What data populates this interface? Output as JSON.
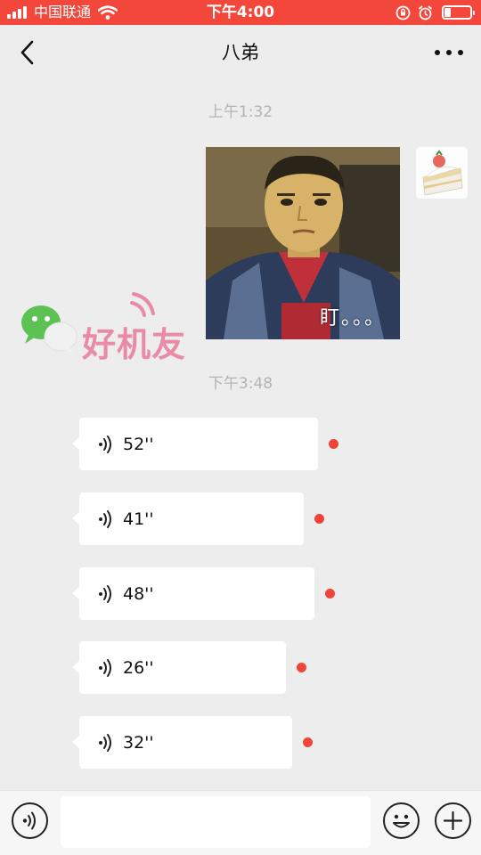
{
  "status_bar": {
    "carrier": "中国联通",
    "time": "下午4:00",
    "battery_level": 0.25,
    "background_color": "#f2473a"
  },
  "nav": {
    "title": "八弟",
    "back_icon": "chevron-left-icon",
    "more_icon": "ellipsis-icon"
  },
  "chat": {
    "timestamps": [
      "上午1:32",
      "下午3:48"
    ],
    "image_message": {
      "caption": "盯。。。"
    },
    "voice_messages": [
      {
        "duration": "52''",
        "unread": true
      },
      {
        "duration": "41''",
        "unread": true
      },
      {
        "duration": "48''",
        "unread": true
      },
      {
        "duration": "26''",
        "unread": true
      },
      {
        "duration": "32''",
        "unread": true
      }
    ]
  },
  "watermark": {
    "text": "好机友"
  },
  "input_bar": {
    "voice_icon": "voice-mode-icon",
    "emoji_icon": "emoji-icon",
    "plus_icon": "plus-icon",
    "text_value": ""
  },
  "colors": {
    "accent_red": "#f2473a",
    "unread_dot": "#f0443a",
    "chat_background": "#ededed"
  }
}
